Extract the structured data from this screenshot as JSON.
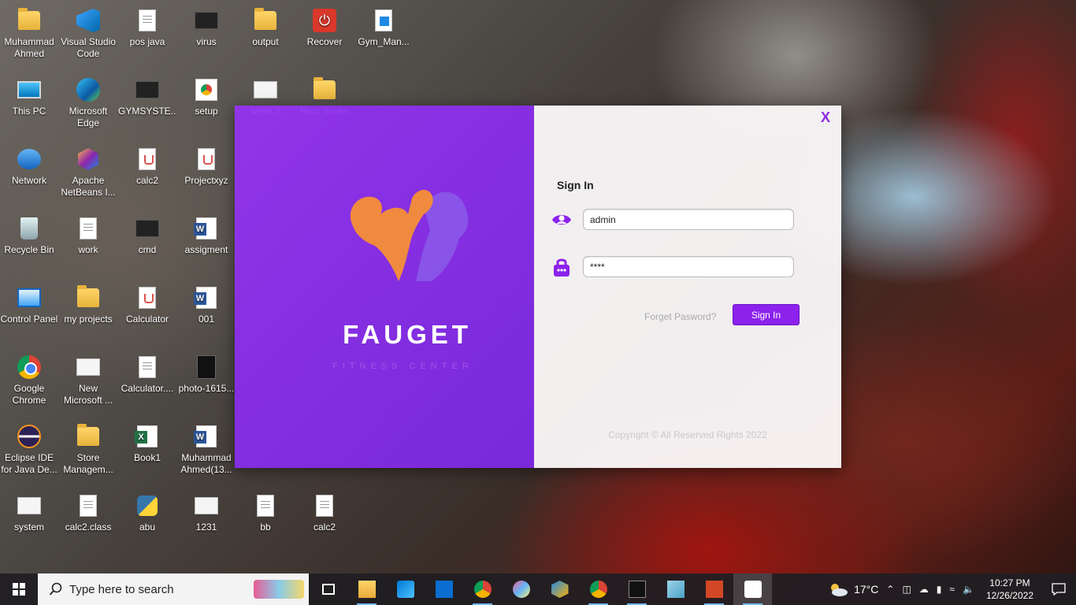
{
  "desktop": {
    "icons": [
      {
        "label": "Muhammad Ahmed",
        "icon": "user-folder-icon"
      },
      {
        "label": "Visual Studio Code",
        "icon": "vscode-icon"
      },
      {
        "label": "pos java",
        "icon": "document-icon"
      },
      {
        "label": "virus",
        "icon": "dark-window-icon"
      },
      {
        "label": "output",
        "icon": "folder-icon"
      },
      {
        "label": "Recover",
        "icon": "recover-icon"
      },
      {
        "label": "Gym_Man...",
        "icon": "blue-document-icon"
      },
      {
        "label": "This PC",
        "icon": "this-pc-icon"
      },
      {
        "label": "Microsoft Edge",
        "icon": "edge-icon"
      },
      {
        "label": "GYMSYSTE...",
        "icon": "dark-window-icon"
      },
      {
        "label": "setup",
        "icon": "chrome-document-icon"
      },
      {
        "label": "week 2",
        "icon": "new-document-icon"
      },
      {
        "label": "Bscs Books",
        "icon": "folder-icon"
      },
      {
        "label": "Network",
        "icon": "network-icon"
      },
      {
        "label": "Apache NetBeans I...",
        "icon": "netbeans-icon"
      },
      {
        "label": "calc2",
        "icon": "java-file-icon"
      },
      {
        "label": "Projectxyz",
        "icon": "java-file-icon"
      },
      {
        "label": "Recycle Bin",
        "icon": "recycle-bin-icon"
      },
      {
        "label": "work",
        "icon": "document-icon"
      },
      {
        "label": "cmd",
        "icon": "dark-window-icon"
      },
      {
        "label": "assigment",
        "icon": "word-icon"
      },
      {
        "label": "Control Panel",
        "icon": "control-panel-icon"
      },
      {
        "label": "my projects",
        "icon": "folder-icon"
      },
      {
        "label": "Calculator",
        "icon": "java-file-icon"
      },
      {
        "label": "001",
        "icon": "word-icon"
      },
      {
        "label": "Google Chrome",
        "icon": "chrome-icon"
      },
      {
        "label": "New Microsoft ...",
        "icon": "new-document-icon"
      },
      {
        "label": "Calculator....",
        "icon": "document-icon"
      },
      {
        "label": "photo-1615...",
        "icon": "photo-icon"
      },
      {
        "label": "Eclipse IDE for Java De...",
        "icon": "eclipse-icon"
      },
      {
        "label": "Store Managem...",
        "icon": "folder-icon"
      },
      {
        "label": "Book1",
        "icon": "excel-icon"
      },
      {
        "label": "Muhammad Ahmed(13...",
        "icon": "word-icon"
      },
      {
        "label": "system",
        "icon": "new-document-icon"
      },
      {
        "label": "calc2.class",
        "icon": "document-icon"
      },
      {
        "label": "abu",
        "icon": "python-icon"
      },
      {
        "label": "1231",
        "icon": "new-document-icon"
      },
      {
        "label": "bb",
        "icon": "document-icon"
      },
      {
        "label": "calc2",
        "icon": "document-icon"
      }
    ]
  },
  "login": {
    "brand_name": "FAUGET",
    "brand_sub": "FITNESS CENTER",
    "close_label": "X",
    "title": "Sign In",
    "username_value": "admin",
    "password_value": "****",
    "forget_label": "Forget Pasword?",
    "signin_label": "Sign In",
    "copyright": "Copyright © All Reserved Rights 2022",
    "accent_color": "#8c22ec"
  },
  "taskbar": {
    "search_placeholder": "Type here to search",
    "apps": [
      "task-view-icon",
      "file-explorer-icon",
      "store-icon",
      "mail-icon",
      "chrome-icon",
      "paint-icon",
      "virtualbox-icon",
      "chrome-profile-icon",
      "terminal-icon",
      "notepad-icon",
      "powerpoint-icon",
      "java-icon"
    ],
    "weather": "17°C",
    "time": "10:27 PM",
    "date": "12/26/2022"
  }
}
